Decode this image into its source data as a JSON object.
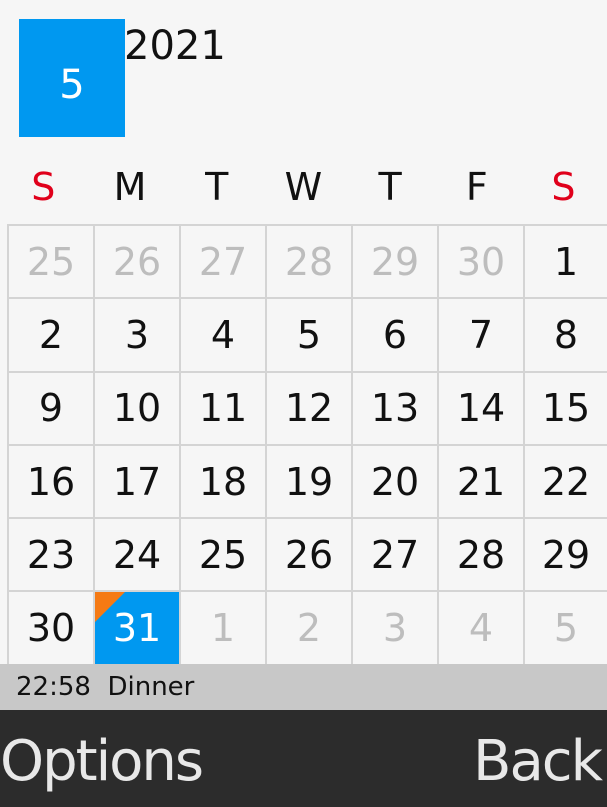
{
  "header": {
    "month": "5",
    "year": "2021"
  },
  "weekdays": [
    {
      "label": "S",
      "weekend": true
    },
    {
      "label": "M",
      "weekend": false
    },
    {
      "label": "T",
      "weekend": false
    },
    {
      "label": "W",
      "weekend": false
    },
    {
      "label": "T",
      "weekend": false
    },
    {
      "label": "F",
      "weekend": false
    },
    {
      "label": "S",
      "weekend": true
    }
  ],
  "days": [
    {
      "label": "25",
      "muted": true
    },
    {
      "label": "26",
      "muted": true
    },
    {
      "label": "27",
      "muted": true
    },
    {
      "label": "28",
      "muted": true
    },
    {
      "label": "29",
      "muted": true
    },
    {
      "label": "30",
      "muted": true
    },
    {
      "label": "1"
    },
    {
      "label": "2"
    },
    {
      "label": "3"
    },
    {
      "label": "4"
    },
    {
      "label": "5"
    },
    {
      "label": "6"
    },
    {
      "label": "7"
    },
    {
      "label": "8"
    },
    {
      "label": "9"
    },
    {
      "label": "10"
    },
    {
      "label": "11"
    },
    {
      "label": "12"
    },
    {
      "label": "13"
    },
    {
      "label": "14"
    },
    {
      "label": "15"
    },
    {
      "label": "16"
    },
    {
      "label": "17"
    },
    {
      "label": "18"
    },
    {
      "label": "19"
    },
    {
      "label": "20"
    },
    {
      "label": "21"
    },
    {
      "label": "22"
    },
    {
      "label": "23"
    },
    {
      "label": "24"
    },
    {
      "label": "25"
    },
    {
      "label": "26"
    },
    {
      "label": "27"
    },
    {
      "label": "28"
    },
    {
      "label": "29"
    },
    {
      "label": "30"
    },
    {
      "label": "31",
      "selected": true,
      "has_event": true
    },
    {
      "label": "1",
      "muted": true
    },
    {
      "label": "2",
      "muted": true
    },
    {
      "label": "3",
      "muted": true
    },
    {
      "label": "4",
      "muted": true
    },
    {
      "label": "5",
      "muted": true
    }
  ],
  "event": {
    "time": "22:58",
    "title": "Dinner"
  },
  "softkeys": {
    "left": "Options",
    "right": "Back"
  },
  "colors": {
    "accent": "#0098f0",
    "event_marker": "#f57a14",
    "weekend": "#e0001b"
  }
}
